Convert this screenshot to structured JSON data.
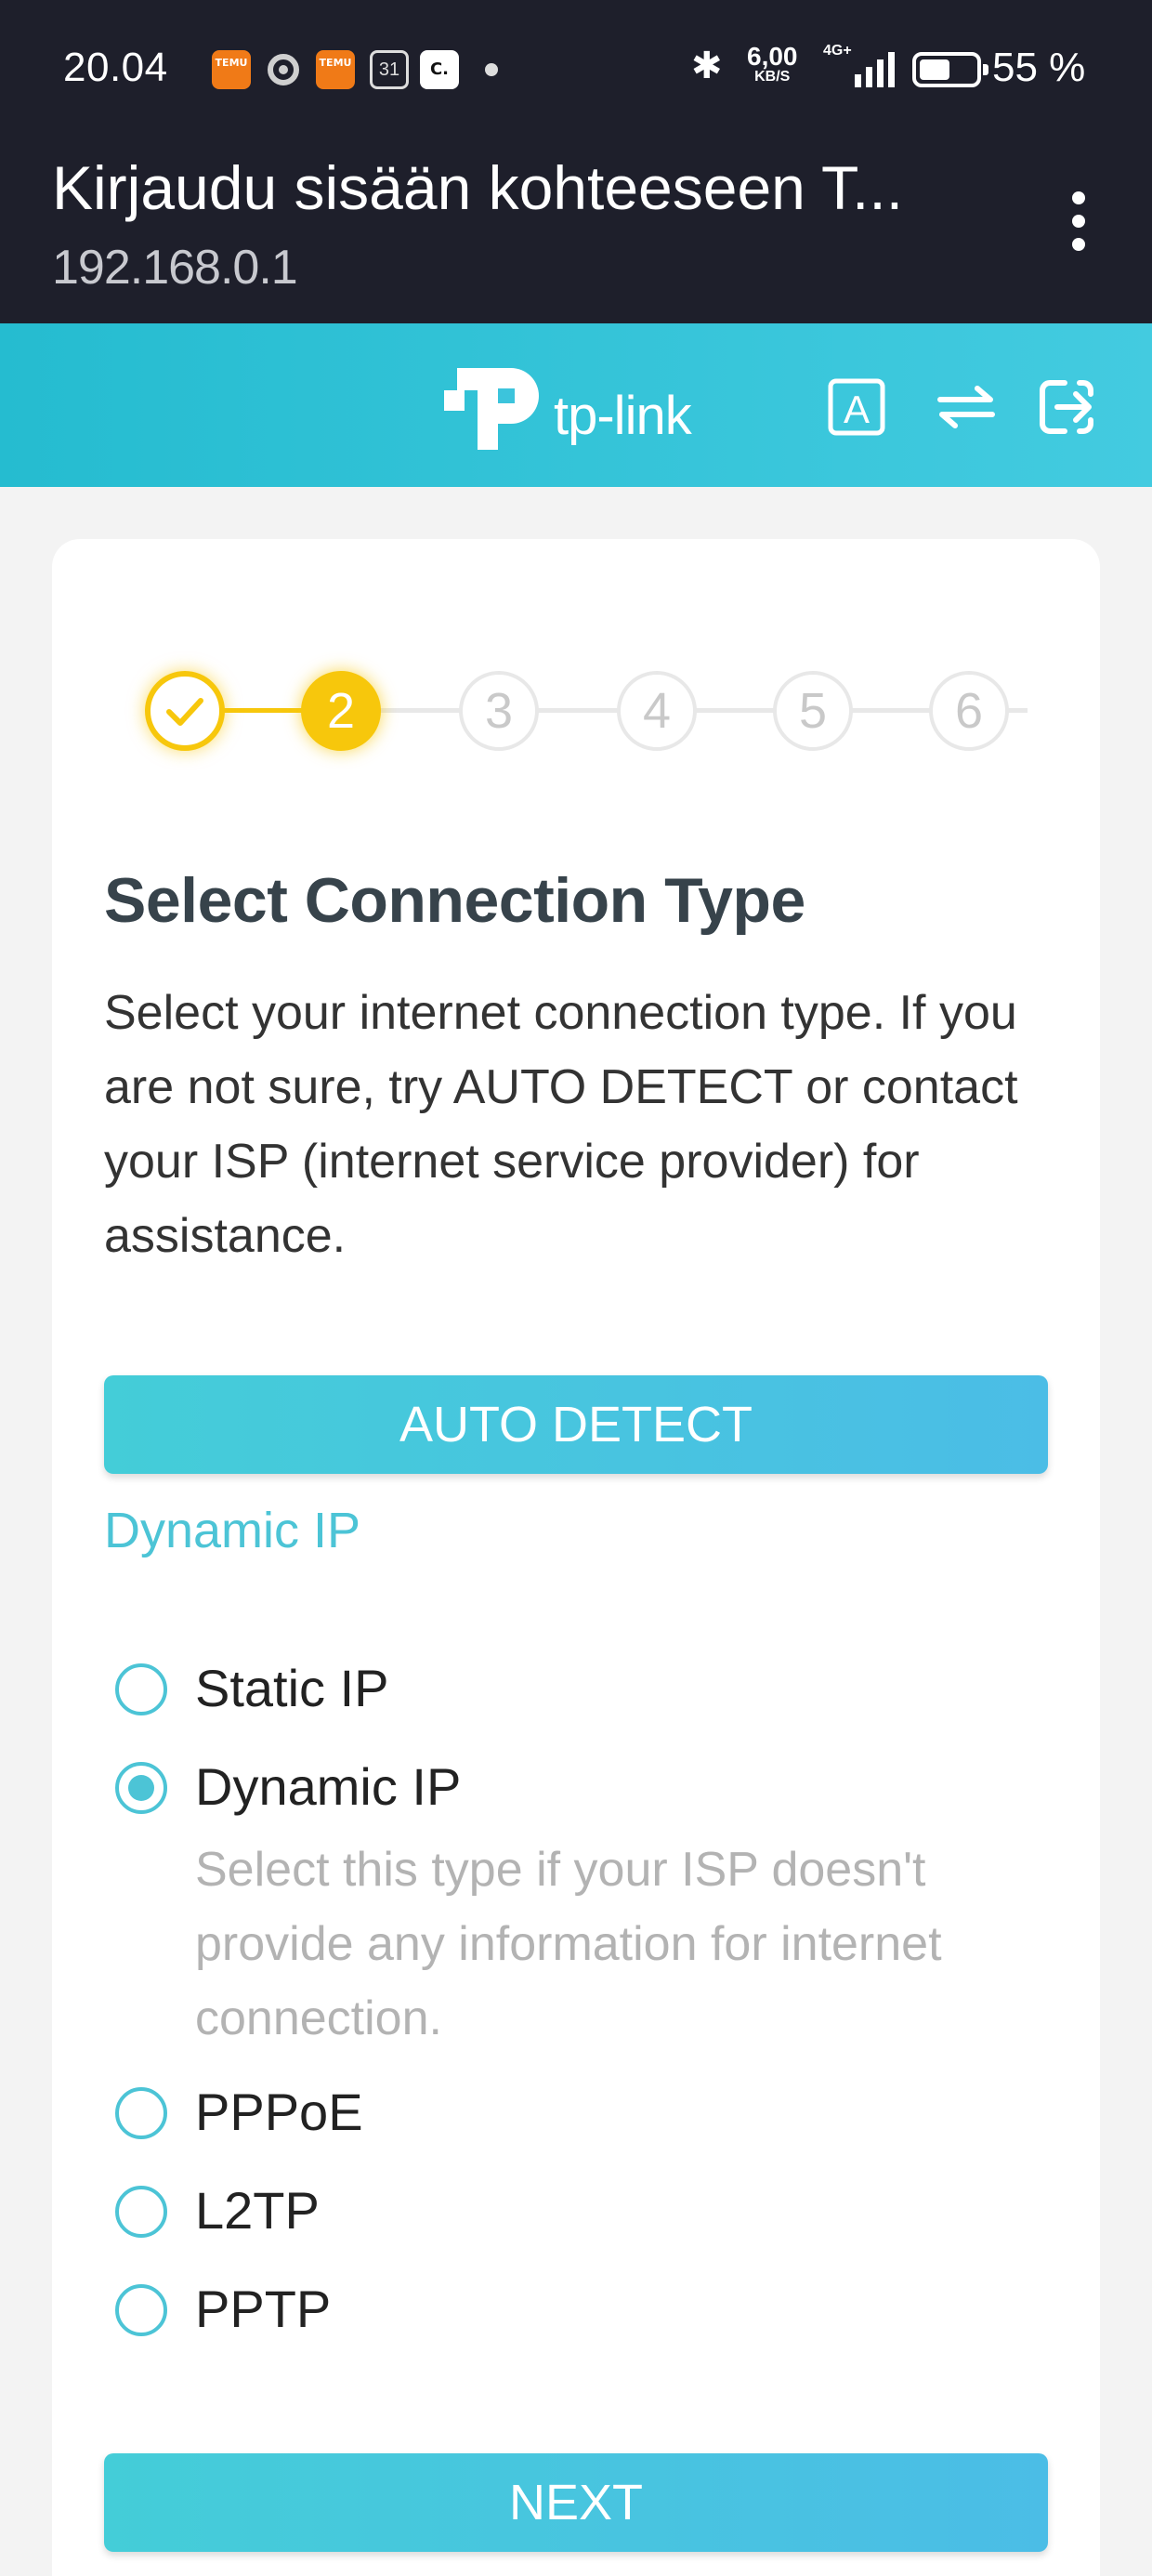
{
  "status_bar": {
    "time": "20.04",
    "notification_icons": [
      "temu-icon",
      "chrome-icon",
      "temu-icon",
      "calendar-icon",
      "app-icon"
    ],
    "calendar_day": "31",
    "temu_label": "TEMU",
    "cc_label": "C.",
    "net_speed": "6,00",
    "net_speed_unit": "KB/S",
    "network_type": "4G+",
    "battery_percent_text": "55 %",
    "battery_level": 0.55
  },
  "browser": {
    "title": "Kirjaudu sisään kohteeseen T...",
    "url": "192.168.0.1",
    "menu_icon": "more-vert-icon"
  },
  "header": {
    "logo_text": "tp-link",
    "icons": [
      "language-icon",
      "swap-icon",
      "logout-icon"
    ],
    "language_glyph": "A"
  },
  "wizard": {
    "steps": [
      {
        "label": "",
        "state": "done"
      },
      {
        "label": "2",
        "state": "active"
      },
      {
        "label": "3",
        "state": "todo"
      },
      {
        "label": "4",
        "state": "todo"
      },
      {
        "label": "5",
        "state": "todo"
      },
      {
        "label": "6",
        "state": "todo"
      }
    ],
    "heading": "Select Connection Type",
    "description": "Select your internet connection type. If you are not sure, try AUTO DETECT or contact your ISP (internet service provider) for assistance.",
    "auto_detect_label": "AUTO DETECT",
    "detected_type": "Dynamic IP",
    "options": [
      {
        "label": "Static IP",
        "selected": false
      },
      {
        "label": "Dynamic IP",
        "selected": true
      },
      {
        "label": "PPPoE",
        "selected": false
      },
      {
        "label": "L2TP",
        "selected": false
      },
      {
        "label": "PPTP",
        "selected": false
      }
    ],
    "selected_hint": "Select this type if your ISP doesn't provide any information for internet connection.",
    "next_label": "NEXT"
  },
  "colors": {
    "accent": "#4cc4d6",
    "step_yellow": "#f7c70c",
    "dark_bar": "#1e1f2b"
  }
}
